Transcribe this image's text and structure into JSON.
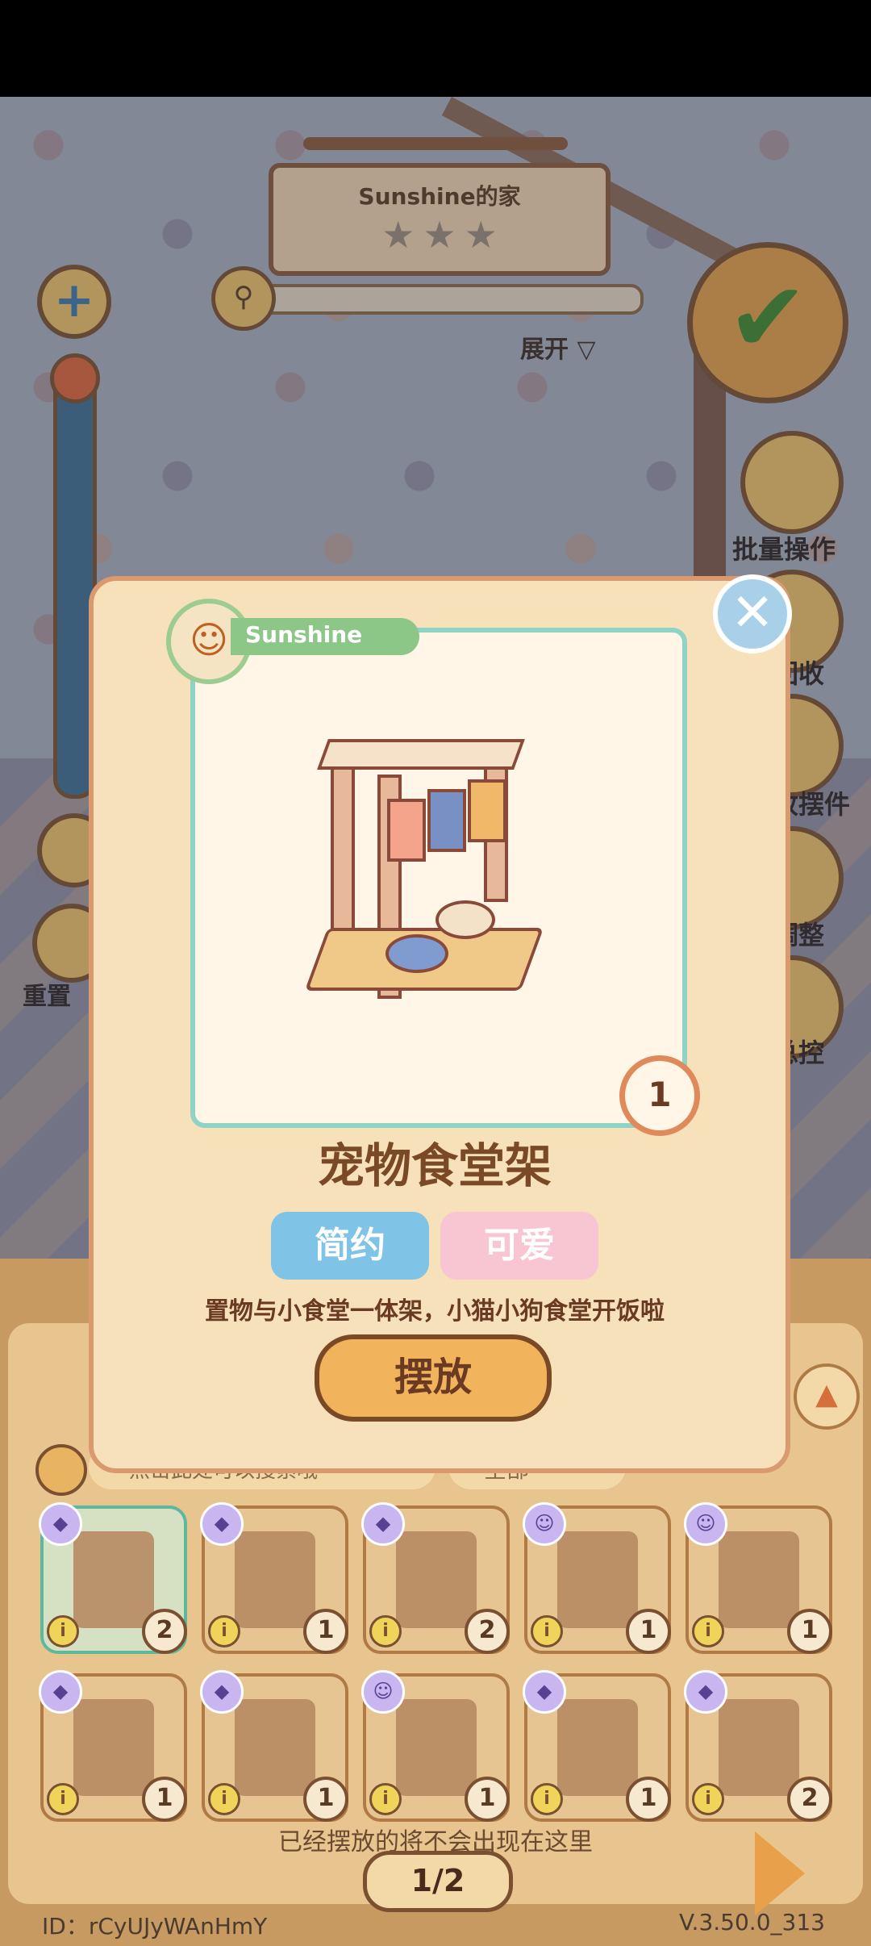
{
  "room": {
    "title": "Sunshine的家",
    "stars": [
      "★",
      "★",
      "★"
    ],
    "expand_label": "展开 ▽"
  },
  "side_buttons": [
    {
      "label": "批量操作",
      "icon": "batch-icon"
    },
    {
      "label": "回收",
      "icon": "recycle-icon"
    },
    {
      "label": "收摆件",
      "icon": "collect-icon"
    },
    {
      "label": "调整",
      "icon": "moon-icon"
    },
    {
      "label": "总控",
      "icon": "bulb-icon"
    }
  ],
  "left_buttons": {
    "reset_label": "重置"
  },
  "modal": {
    "owner_name": "Sunshine",
    "quantity": "1",
    "item_name": "宠物食堂架",
    "tags": [
      "简约",
      "可爱"
    ],
    "description": "置物与小食堂一体架，小猫小狗食堂开饭啦",
    "action_label": "摆放",
    "close_symbol": "✕"
  },
  "inventory": {
    "search_hint": "点击此处可以搜索哦",
    "filter_label": "全部",
    "items": [
      {
        "count": "2",
        "source": "box"
      },
      {
        "count": "1",
        "source": "box"
      },
      {
        "count": "2",
        "source": "box"
      },
      {
        "count": "1",
        "source": "sun"
      },
      {
        "count": "1",
        "source": "sun"
      },
      {
        "count": "1",
        "source": "box"
      },
      {
        "count": "1",
        "source": "box"
      },
      {
        "count": "1",
        "source": "sun"
      },
      {
        "count": "1",
        "source": "box"
      },
      {
        "count": "2",
        "source": "box"
      }
    ],
    "footnote": "已经摆放的将不会出现在这里",
    "page": "1/2"
  },
  "footer": {
    "id_text": "ID：rCyUJyWAnHmY",
    "version": "V.3.50.0_313"
  },
  "colors": {
    "modal_bg": "#f7e1ba",
    "frame_border": "#8fd2c6",
    "tag_simple": "#7fc3e6",
    "tag_cute": "#f7c6d2",
    "action_button": "#f1b35c"
  }
}
